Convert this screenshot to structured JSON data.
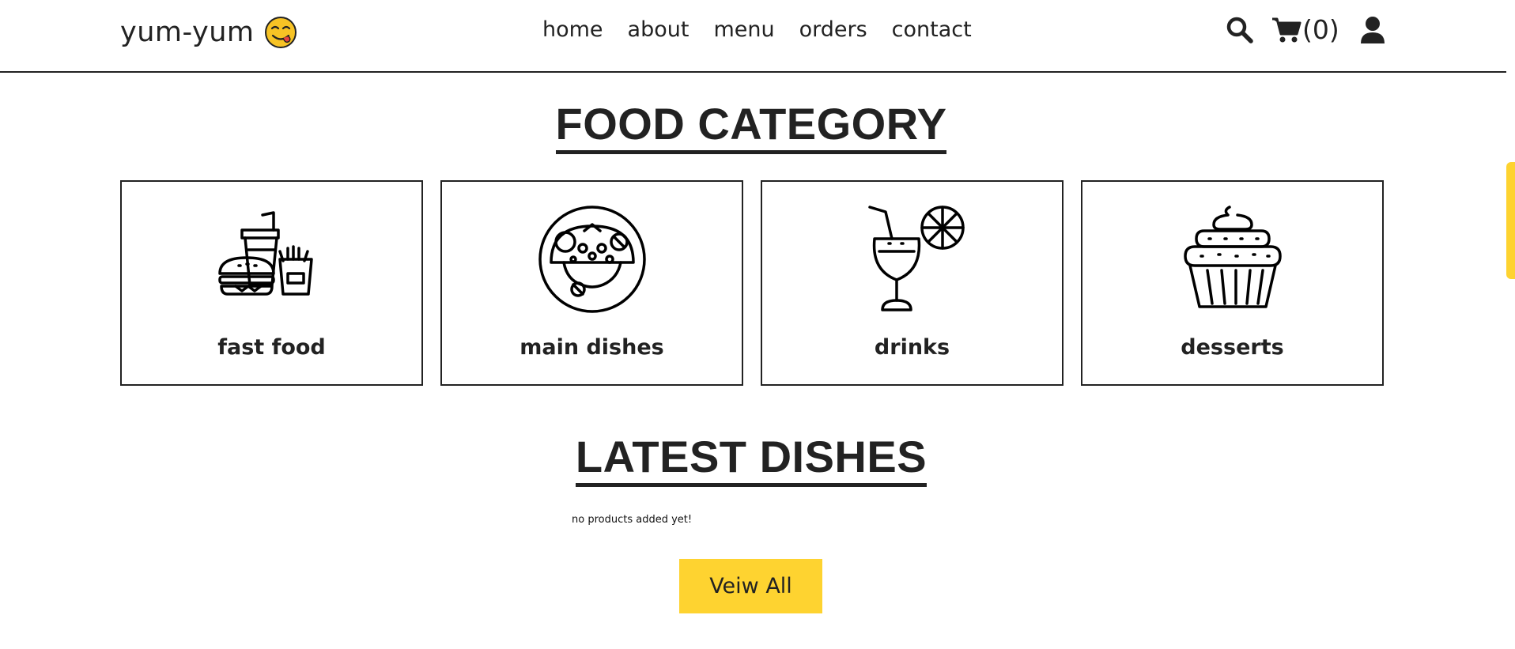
{
  "header": {
    "logo": "yum-yum",
    "logo_icon": "yummy-face-emoji",
    "nav": [
      {
        "label": "home"
      },
      {
        "label": "about"
      },
      {
        "label": "menu"
      },
      {
        "label": "orders"
      },
      {
        "label": "contact"
      }
    ],
    "cart_count": "(0)",
    "icons": [
      "search-icon",
      "cart-icon",
      "user-icon"
    ]
  },
  "category_section": {
    "title": "FOOD CATEGORY",
    "items": [
      {
        "label": "fast food",
        "icon": "fast-food-icon"
      },
      {
        "label": "main dishes",
        "icon": "main-dish-icon"
      },
      {
        "label": "drinks",
        "icon": "drink-icon"
      },
      {
        "label": "desserts",
        "icon": "cupcake-icon"
      }
    ]
  },
  "latest_section": {
    "title": "LATEST DISHES",
    "empty_text": "no products added yet!",
    "button_label": "Veiw All"
  },
  "colors": {
    "accent": "#fed330",
    "text": "#222222",
    "background": "#ffffff"
  }
}
